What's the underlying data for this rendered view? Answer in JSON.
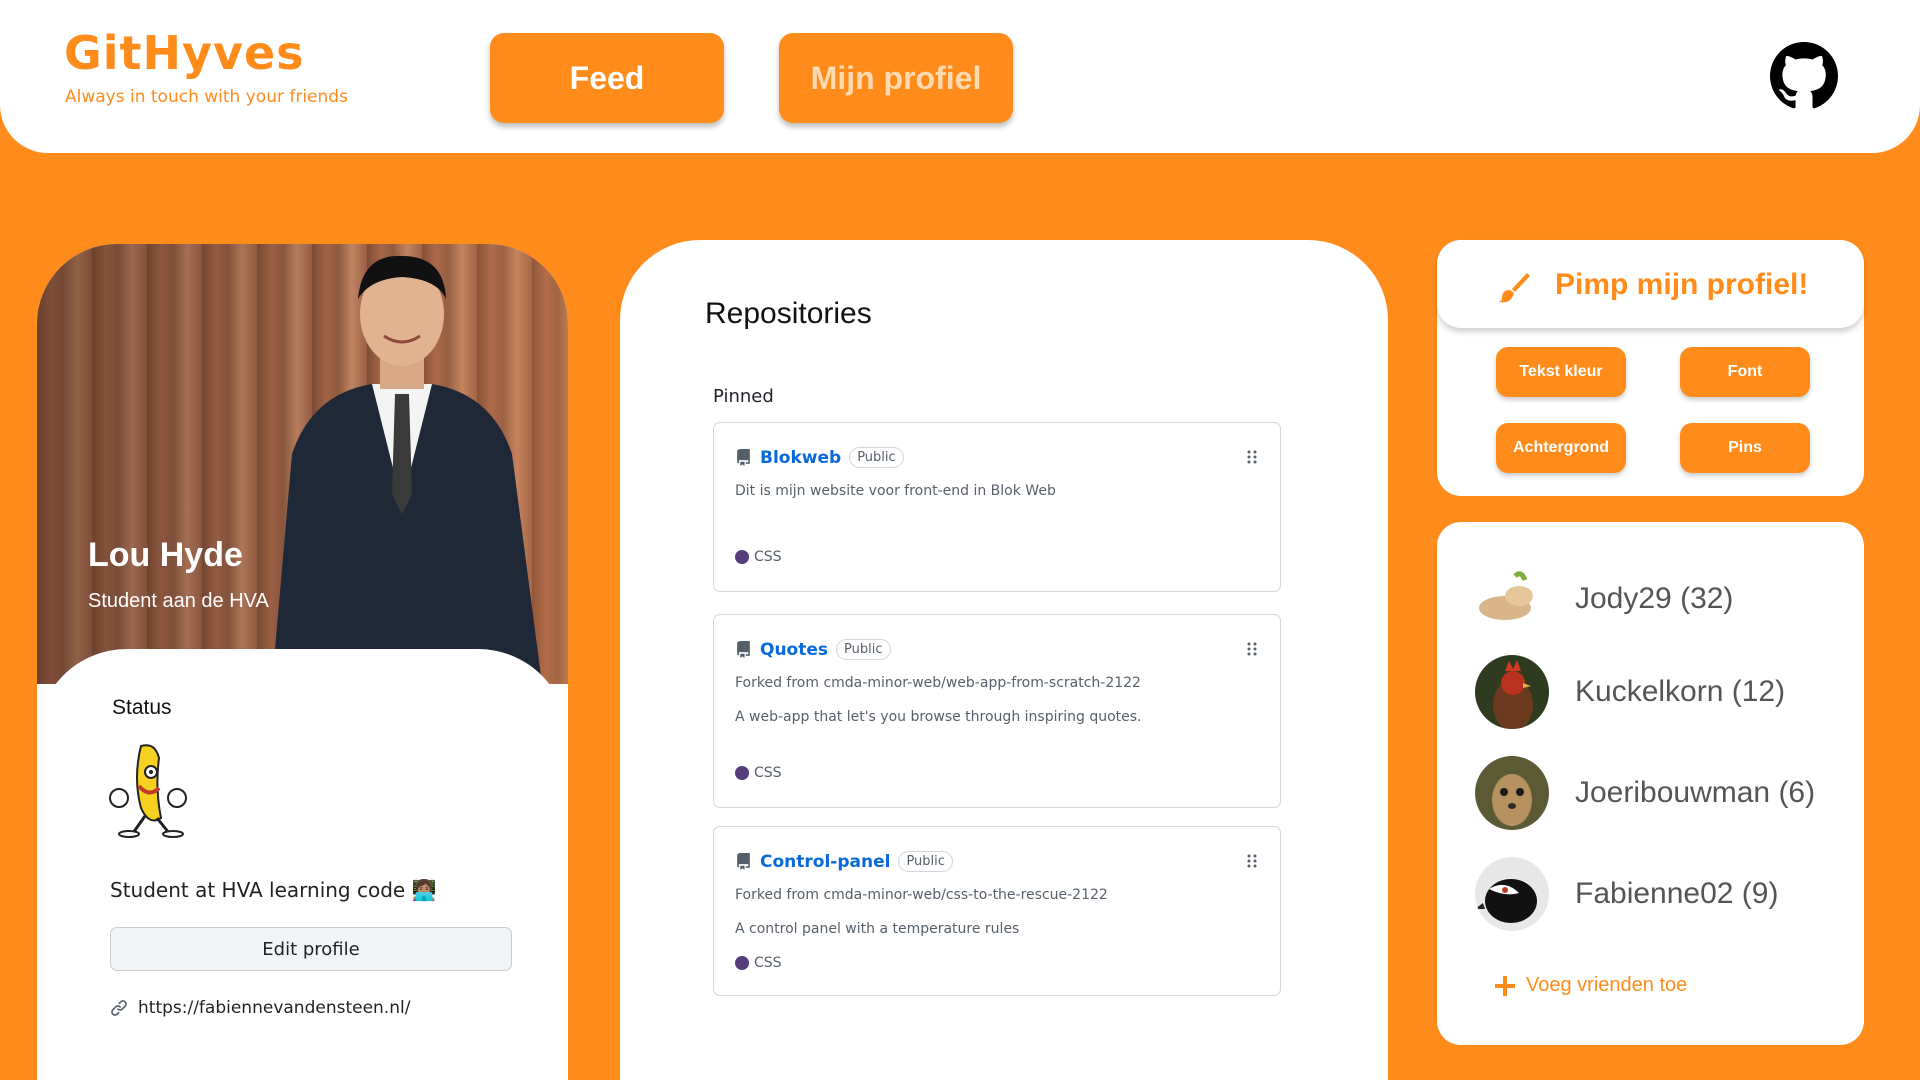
{
  "header": {
    "logo_title": "GitHyves",
    "logo_subtitle": "Always in touch with your friends",
    "nav": [
      {
        "label": "Feed"
      },
      {
        "label": "Mijn profiel"
      }
    ],
    "github_icon": "github-icon"
  },
  "profile": {
    "name": "Lou Hyde",
    "role": "Student aan de HVA",
    "status_label": "Status",
    "status_icon": "dancing-banana",
    "bio": "Student at HVA learning code 👩🏽‍💻",
    "edit_button": "Edit profile",
    "website": "https://fabiennevandensteen.nl/",
    "link_icon": "link-icon"
  },
  "repositories": {
    "title": "Repositories",
    "pinned_label": "Pinned",
    "items": [
      {
        "name": "Blokweb",
        "visibility": "Public",
        "forked_from": "",
        "description": "Dit is mijn website voor front-end in Blok Web",
        "language": "CSS",
        "language_color": "#563d7c"
      },
      {
        "name": "Quotes",
        "visibility": "Public",
        "forked_from": "Forked from cmda-minor-web/web-app-from-scratch-2122",
        "description": "A web-app that let's you browse through inspiring quotes.",
        "language": "CSS",
        "language_color": "#563d7c"
      },
      {
        "name": "Control-panel",
        "visibility": "Public",
        "forked_from": "Forked from cmda-minor-web/css-to-the-rescue-2122",
        "description": "A control panel with a temperature rules",
        "language": "CSS",
        "language_color": "#563d7c"
      }
    ]
  },
  "pimp": {
    "title": "Pimp mijn profiel!",
    "icon": "paintbrush-icon",
    "buttons": [
      "Tekst kleur",
      "Font",
      "Achtergrond",
      "Pins"
    ]
  },
  "friends": {
    "items": [
      {
        "name": "Jody29 (32)"
      },
      {
        "name": "Kuckelkorn (12)"
      },
      {
        "name": "Joeribouwman (6)"
      },
      {
        "name": "Fabienne02 (9)"
      }
    ],
    "add_label": "Voeg vrienden toe"
  },
  "colors": {
    "accent": "#ff8c1a",
    "link": "#0969da",
    "css_language": "#563d7c"
  }
}
